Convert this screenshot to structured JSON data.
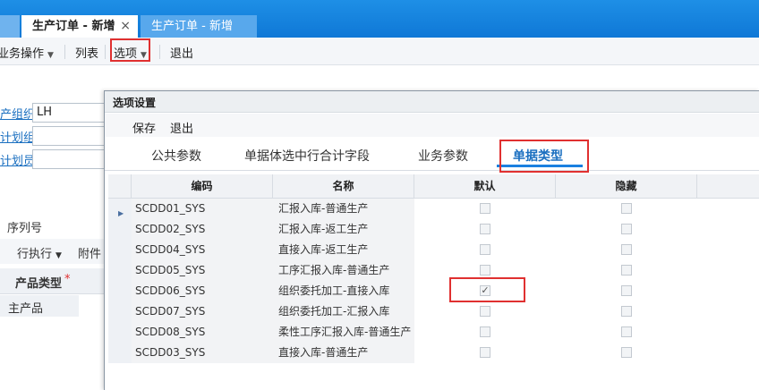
{
  "tabs": [
    {
      "label": "生产订单 - 新增",
      "close": "×"
    },
    {
      "label": "生产订单 - 新增"
    }
  ],
  "toolbar": {
    "biz_ops": "业务操作",
    "list": "列表",
    "options": "选项",
    "exit": "退出"
  },
  "background_form": {
    "org_label": "产组织",
    "org_value": "LH",
    "plan_group_label": "计划组",
    "planner_label": "计划员",
    "serial_label": "序列号",
    "exec_label": "行执行",
    "attach_label": "附件",
    "product_type_header": "产品类型",
    "required_mark": "*",
    "product_type_value": "主产品"
  },
  "dialog": {
    "title": "选项设置",
    "save": "保存",
    "exit": "退出",
    "tabs": [
      "公共参数",
      "单据体选中行合计字段",
      "业务参数",
      "单据类型"
    ],
    "active_tab": 3,
    "columns": [
      "编码",
      "名称",
      "默认",
      "隐藏"
    ],
    "rows": [
      {
        "code": "SCDD01_SYS",
        "name": "汇报入库-普通生产",
        "default": false,
        "hidden": false
      },
      {
        "code": "SCDD02_SYS",
        "name": "汇报入库-返工生产",
        "default": false,
        "hidden": false
      },
      {
        "code": "SCDD04_SYS",
        "name": "直接入库-返工生产",
        "default": false,
        "hidden": false
      },
      {
        "code": "SCDD05_SYS",
        "name": "工序汇报入库-普通生产",
        "default": false,
        "hidden": false
      },
      {
        "code": "SCDD06_SYS",
        "name": "组织委托加工-直接入库",
        "default": true,
        "hidden": false
      },
      {
        "code": "SCDD07_SYS",
        "name": "组织委托加工-汇报入库",
        "default": false,
        "hidden": false
      },
      {
        "code": "SCDD08_SYS",
        "name": "柔性工序汇报入库-普通生产",
        "default": false,
        "hidden": false
      },
      {
        "code": "SCDD03_SYS",
        "name": "直接入库-普通生产",
        "default": false,
        "hidden": false
      }
    ]
  },
  "colors": {
    "accent": "#1a80e0",
    "highlight": "#e03030",
    "tabbar": "#1a88e4"
  }
}
